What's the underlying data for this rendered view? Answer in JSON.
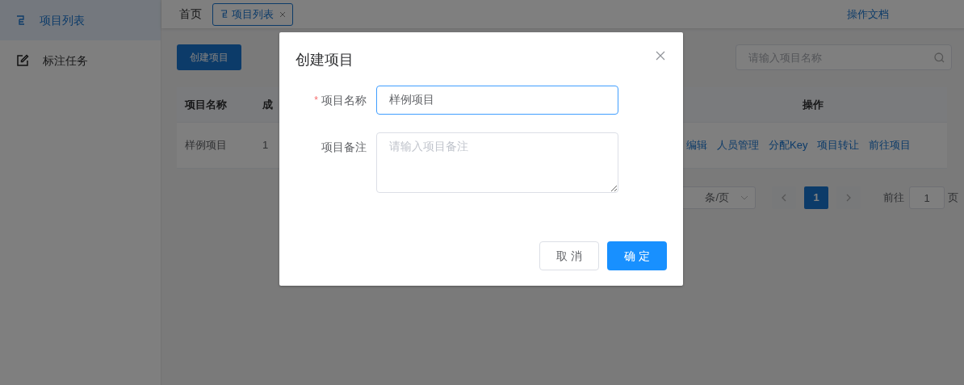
{
  "sidebar": {
    "items": [
      {
        "label": "项目列表",
        "selected": true
      },
      {
        "label": "标注任务",
        "selected": false
      }
    ]
  },
  "header": {
    "breadcrumb": "首页",
    "tabs": [
      {
        "label": "项目列表",
        "selected": true
      }
    ],
    "docs_link": "操作文档"
  },
  "toolbar": {
    "create_button": "创建项目",
    "search": {
      "placeholder": "请输入项目名称"
    }
  },
  "table": {
    "columns": [
      "项目名称",
      "成",
      "操作"
    ],
    "rows": [
      {
        "name": "样例项目",
        "members": "1",
        "actions": [
          "编辑",
          "人员管理",
          "分配Key",
          "项目转让",
          "前往项目"
        ]
      }
    ]
  },
  "pagination": {
    "page_size": "条/页",
    "pages": [
      {
        "label": "1",
        "selected": true
      }
    ],
    "goto_label": "前往",
    "goto_value": "1",
    "page_suffix": "页"
  },
  "dialog": {
    "title": "创建项目",
    "fields": [
      {
        "required_mark": "*",
        "label": "项目名称",
        "kind": "input",
        "value": "样例项目",
        "focused": true
      },
      {
        "label": "项目备注",
        "kind": "textarea",
        "placeholder": "请输入项目备注",
        "focused": false
      }
    ],
    "buttons": [
      {
        "label": "取 消",
        "primary": false
      },
      {
        "label": "确 定",
        "primary": true
      }
    ]
  }
}
